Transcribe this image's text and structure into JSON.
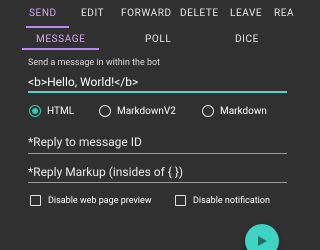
{
  "tabs_top": [
    {
      "label": "SEND"
    },
    {
      "label": "EDIT"
    },
    {
      "label": "FORWARD"
    },
    {
      "label": "DELETE"
    },
    {
      "label": "LEAVE"
    },
    {
      "label": "REA"
    }
  ],
  "tabs_sub": [
    {
      "label": "MESSAGE"
    },
    {
      "label": "POLL"
    },
    {
      "label": "DICE"
    }
  ],
  "message": {
    "label": "Send a message in within the bot",
    "value": "<b>Hello, World!</b>"
  },
  "parse_mode": {
    "options": [
      "HTML",
      "MarkdownV2",
      "Markdown"
    ],
    "selected": "HTML"
  },
  "reply_to": {
    "placeholder": "*Reply to message ID"
  },
  "reply_markup": {
    "placeholder": "*Reply Markup (insides of { })"
  },
  "checkboxes": [
    {
      "label": "Disable web page preview",
      "checked": false
    },
    {
      "label": "Disable notification",
      "checked": false
    }
  ],
  "colors": {
    "background": "#303030",
    "accent_purple": "#ba86f0",
    "accent_teal": "#3fd3c3"
  },
  "icons": {
    "send": "send-icon"
  }
}
